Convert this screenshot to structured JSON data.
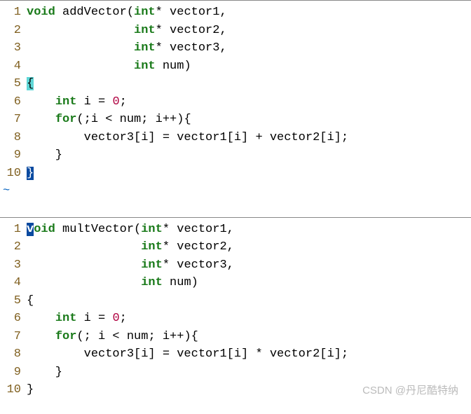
{
  "editor1": {
    "lines": [
      1,
      2,
      3,
      4,
      5,
      6,
      7,
      8,
      9,
      10
    ],
    "t_void": "void",
    "t_fnname": " addVector(",
    "t_int": "int",
    "t_star": "*",
    "t_p1": " vector1,",
    "t_p2": " vector2,",
    "t_p3": " vector3,",
    "t_pnum": " num)",
    "t_brace_open": "{",
    "t_decl_a": "    ",
    "t_decl_b": " i = ",
    "t_zero": "0",
    "t_semi": ";",
    "t_for": "for",
    "t_forcond": "(;i < num; i++){",
    "t_body": "        vector3[i] = vector1[i] + vector2[i];",
    "t_closebrace_inner": "    }",
    "t_brace_close": "}",
    "t_tilde": "~"
  },
  "editor2": {
    "lines": [
      1,
      2,
      3,
      4,
      5,
      6,
      7,
      8,
      9,
      10
    ],
    "t_v": "v",
    "t_oid": "oid",
    "t_fnname": " multVector(",
    "t_int": "int",
    "t_star": "*",
    "t_p1": " vector1,",
    "t_p2": " vector2,",
    "t_p3": " vector3,",
    "t_pnum": " num)",
    "t_brace_open": "{",
    "t_decl_a": "    ",
    "t_decl_b": " i = ",
    "t_zero": "0",
    "t_semi": ";",
    "t_for": "for",
    "t_forcond": "(; i < num; i++){",
    "t_body": "        vector3[i] = vector1[i] * vector2[i];",
    "t_closebrace_inner": "    }",
    "t_brace_close": "}"
  },
  "watermark": "CSDN @丹尼酷特纳"
}
